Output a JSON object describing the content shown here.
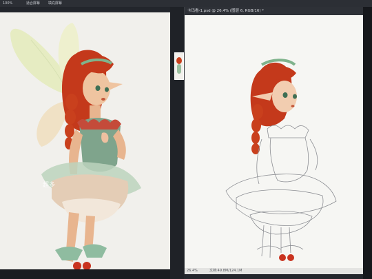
{
  "top_bar": {
    "zoom_left": "100%",
    "menu_a": "适合屏幕",
    "menu_b": "填充屏幕"
  },
  "left_document": {
    "watermark": "超多"
  },
  "right_document": {
    "tab_title": "卡玛看-1.psd @ 26.4% (图层 6, RGB/16) *",
    "status_zoom": "26.4%",
    "status_doc": "文档:49.8M/124.1M"
  },
  "colors": {
    "hair": "#c9401d",
    "dress": "#7fa48c",
    "wing": "#e7ecb8",
    "skin": "#e8b58f",
    "canvas": "#f1f0ec"
  }
}
